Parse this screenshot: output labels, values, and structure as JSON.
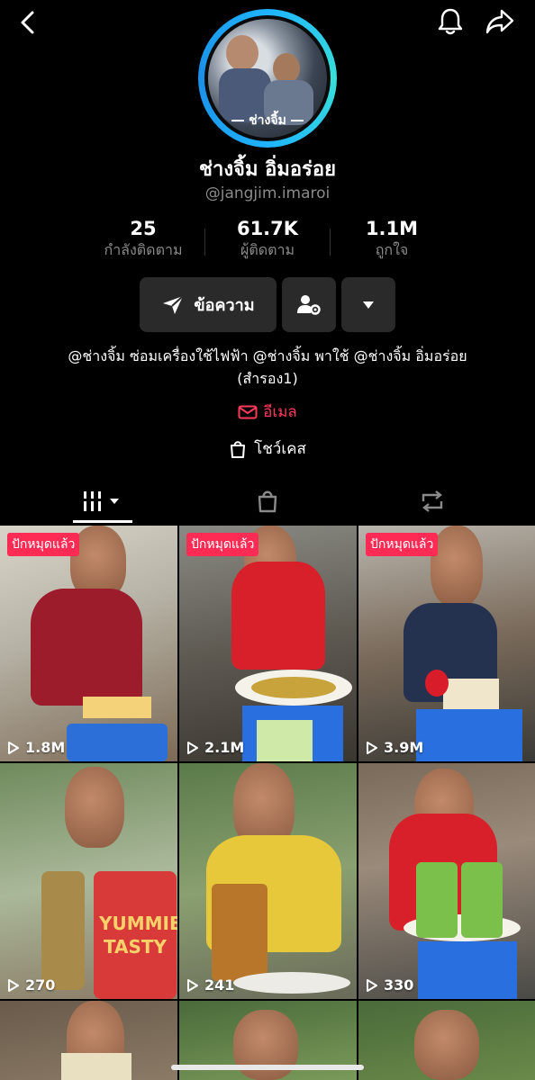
{
  "profile": {
    "avatar_label": "ช่างจิ้ม",
    "display_name": "ช่างจิ้ม อิ่มอร่อย",
    "username": "@jangjim.imaroi"
  },
  "stats": [
    {
      "value": "25",
      "label": "กำลังติดตาม"
    },
    {
      "value": "61.7K",
      "label": "ผู้ติดตาม"
    },
    {
      "value": "1.1M",
      "label": "ถูกใจ"
    }
  ],
  "actions": {
    "message_label": "ข้อความ"
  },
  "bio": {
    "line1": "@ช่างจิ้ม ซ่อมเครื่องใช้ไฟฟ้า @ช่างจิ้ม พาใช้ @ช่างจิ้ม อิ่มอร่อย",
    "line2": "(สำรอง1)"
  },
  "links": {
    "email_label": "อีเมล",
    "showcase_label": "โชว์เคส"
  },
  "videos": [
    {
      "pinned": "ปักหมุดแล้ว",
      "views": "1.8M"
    },
    {
      "pinned": "ปักหมุดแล้ว",
      "views": "2.1M"
    },
    {
      "pinned": "ปักหมุดแล้ว",
      "views": "3.9M"
    },
    {
      "views": "270",
      "package_text": "YUMMIE TASTY"
    },
    {
      "views": "241"
    },
    {
      "views": "330"
    },
    {},
    {},
    {}
  ],
  "colors": {
    "accent": "#fe2c55",
    "email": "#fe3b5c",
    "avatar_ring": "#1fb4ff"
  }
}
